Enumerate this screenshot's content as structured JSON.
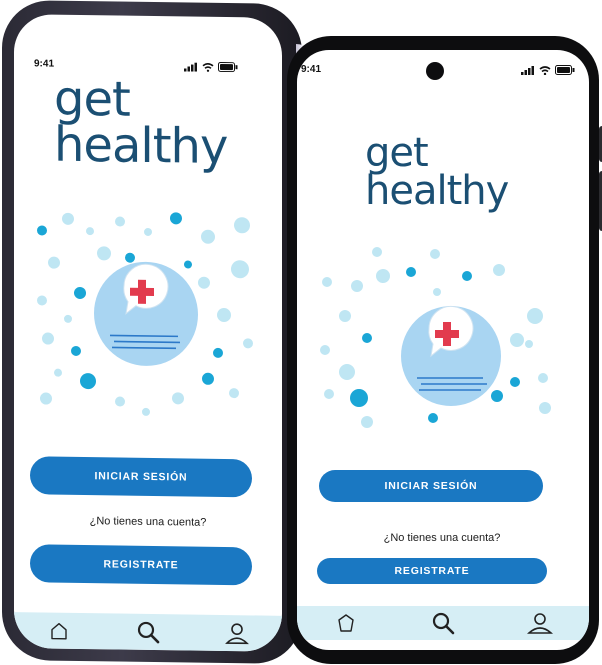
{
  "status": {
    "time": "9:41"
  },
  "app": {
    "logo_line1": "get",
    "logo_line2": "healthy"
  },
  "buttons": {
    "login_label": "INICIAR SESIÓN",
    "register_label": "REGISTRATE"
  },
  "prompt": {
    "no_account": "¿No tienes una cuenta?"
  },
  "tabbar": {
    "items": [
      {
        "icon": "home-icon"
      },
      {
        "icon": "search-icon"
      },
      {
        "icon": "user-icon"
      }
    ]
  },
  "colors": {
    "brand_text": "#1b4f73",
    "button": "#1a78c2",
    "tabbar": "#d6eef5",
    "dot_dark": "#1aa6d6",
    "dot_light": "#bfe6f3",
    "circle": "#a9d5f2",
    "cross": "#e23b4e"
  }
}
